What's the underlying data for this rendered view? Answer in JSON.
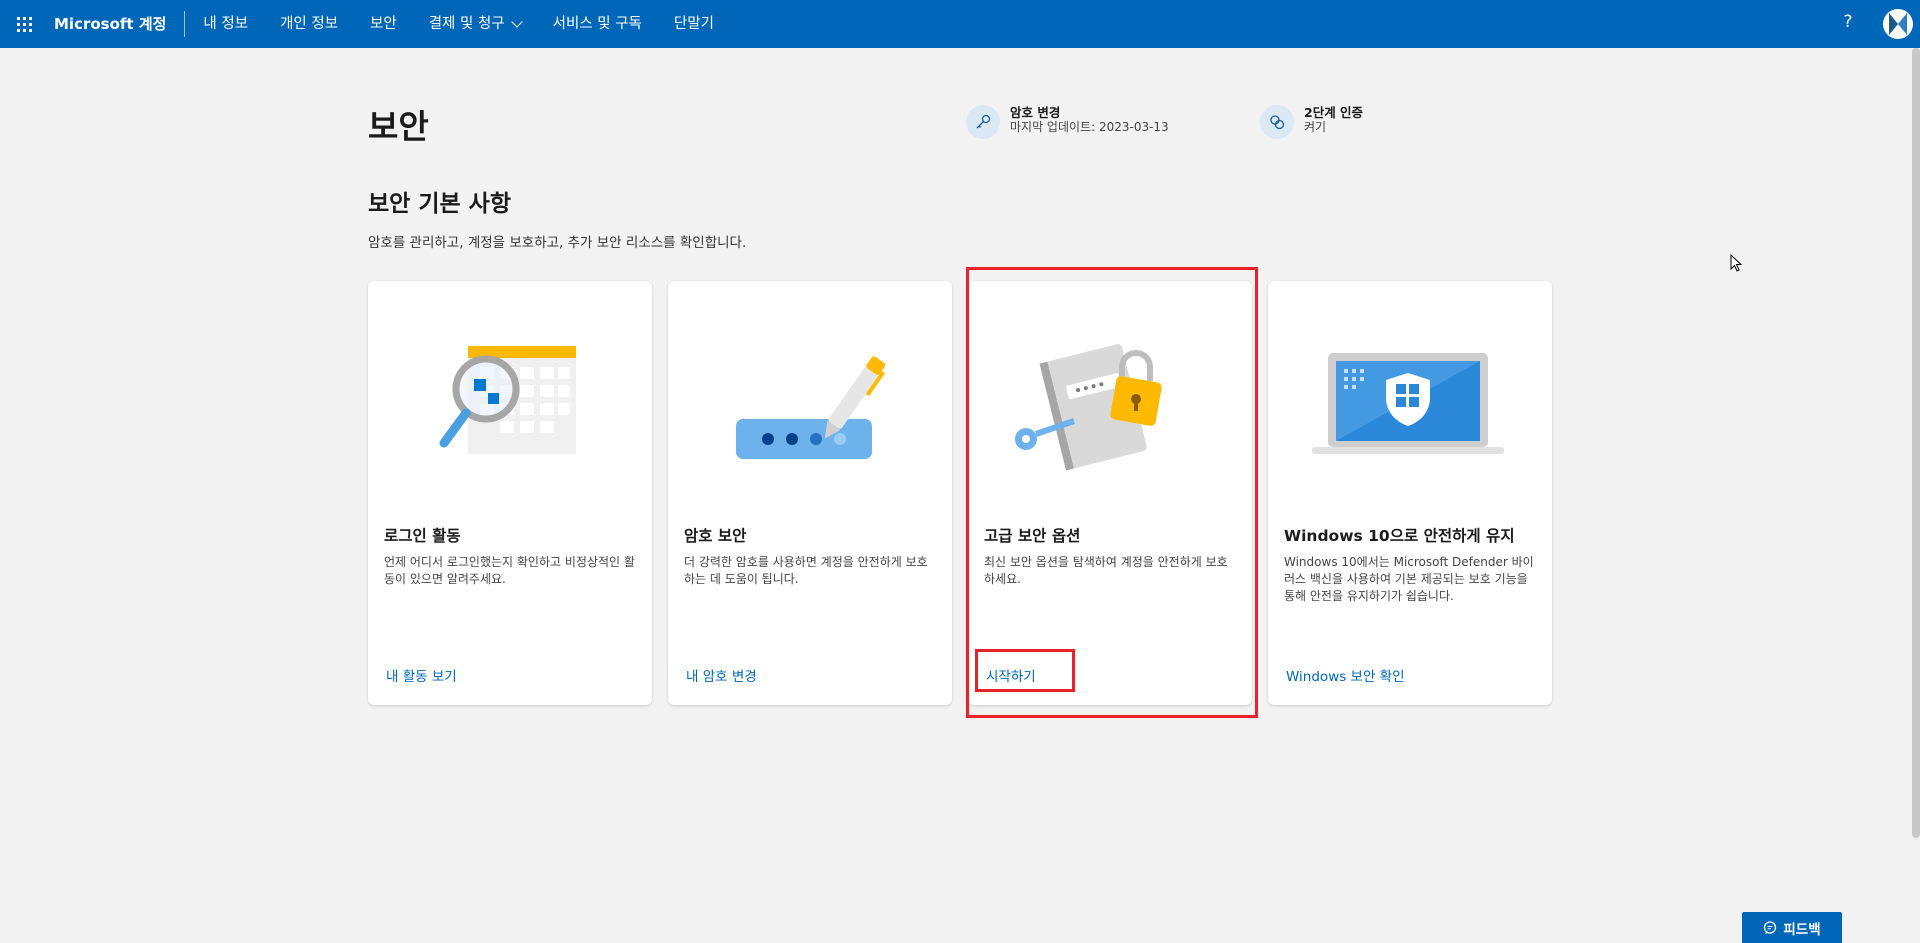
{
  "topbar": {
    "brand": "Microsoft 계정",
    "nav": [
      "내 정보",
      "개인 정보",
      "보안",
      "결제 및 청구",
      "서비스 및 구독",
      "단말기"
    ],
    "help": "?"
  },
  "page": {
    "title": "보안",
    "quick_links": [
      {
        "title": "암호 변경",
        "subtitle": "마지막 업데이트: 2023-03-13",
        "icon": "key-icon"
      },
      {
        "title": "2단계 인증",
        "subtitle": "켜기",
        "icon": "two-step-icon"
      }
    ],
    "section_title": "보안 기본 사항",
    "section_desc": "암호를 관리하고, 계정을 보호하고, 추가 보안 리소스를 확인합니다."
  },
  "cards": [
    {
      "title": "로그인 활동",
      "desc": "언제 어디서 로그인했는지 확인하고 비정상적인 활동이 있으면 알려주세요.",
      "link": "내 활동 보기"
    },
    {
      "title": "암호 보안",
      "desc": "더 강력한 암호를 사용하면 계정을 안전하게 보호하는 데 도움이 됩니다.",
      "link": "내 암호 변경"
    },
    {
      "title": "고급 보안 옵션",
      "desc": "최신 보안 옵션을 탐색하여 계정을 안전하게 보호하세요.",
      "link": "시작하기"
    },
    {
      "title": "Windows 10으로 안전하게 유지",
      "desc": "Windows 10에서는 Microsoft Defender 바이러스 백신을 사용하여 기본 제공되는 보호 기능을 통해 안전을 유지하기가 쉽습니다.",
      "link": "Windows 보안 확인"
    }
  ],
  "feedback": "피드백",
  "colors": {
    "accent": "#0067b8",
    "highlight": "#e8222a"
  }
}
